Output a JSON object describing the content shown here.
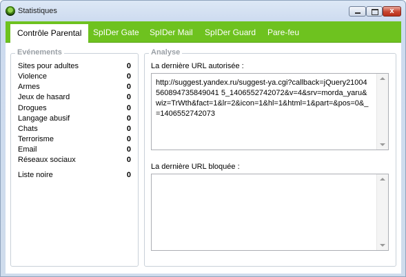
{
  "window": {
    "title": "Statistiques",
    "close_symbol": "x"
  },
  "tabs": [
    {
      "label": "Contrôle Parental"
    },
    {
      "label": "SpIDer Gate"
    },
    {
      "label": "SpIDer Mail"
    },
    {
      "label": "SpIDer Guard"
    },
    {
      "label": "Pare-feu"
    }
  ],
  "events": {
    "title": "Evénements",
    "items": [
      {
        "label": "Sites pour adultes",
        "count": "0"
      },
      {
        "label": "Violence",
        "count": "0"
      },
      {
        "label": "Armes",
        "count": "0"
      },
      {
        "label": "Jeux de hasard",
        "count": "0"
      },
      {
        "label": "Drogues",
        "count": "0"
      },
      {
        "label": "Langage abusif",
        "count": "0"
      },
      {
        "label": "Chats",
        "count": "0"
      },
      {
        "label": "Terrorisme",
        "count": "0"
      },
      {
        "label": "Email",
        "count": "0"
      },
      {
        "label": "Réseaux sociaux",
        "count": "0"
      }
    ],
    "blacklist": {
      "label": "Liste noire",
      "count": "0"
    }
  },
  "analysis": {
    "title": "Analyse",
    "allowed_label": "La dernière URL autorisée :",
    "allowed_url": "http://suggest.yandex.ru/suggest-ya.cgi?callback=jQuery21004560894735849041 5_1406552742072&v=4&srv=morda_yaru&wiz=TrWth&fact=1&lr=2&icon=1&hl=1&html=1&part=&pos=0&_=1406552742073",
    "blocked_label": "La dernière URL bloquée :",
    "blocked_url": ""
  },
  "colors": {
    "accent": "#6ec21f",
    "window_frame": "#cddbef"
  }
}
